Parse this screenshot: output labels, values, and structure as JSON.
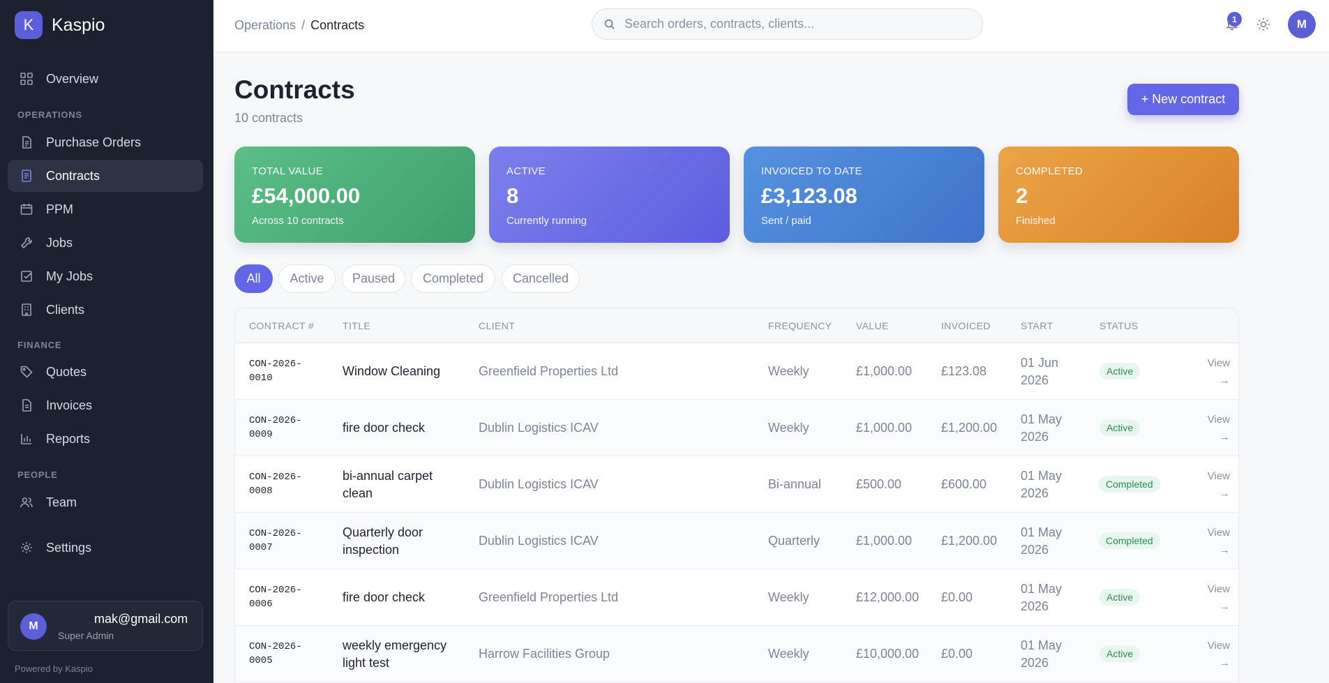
{
  "brand": {
    "logo_letter": "K",
    "name": "Kaspio"
  },
  "sidebar": {
    "overview": "Overview",
    "section_operations": "OPERATIONS",
    "operations": [
      "Purchase Orders",
      "Contracts",
      "PPM",
      "Jobs",
      "My Jobs",
      "Clients"
    ],
    "section_finance": "FINANCE",
    "finance": [
      "Quotes",
      "Invoices",
      "Reports"
    ],
    "section_people": "PEOPLE",
    "people": [
      "Team"
    ],
    "settings": "Settings",
    "active_item": "Contracts"
  },
  "user": {
    "avatar_letter": "M",
    "email": "mak@gmail.com",
    "role": "Super Admin"
  },
  "powered_by": "Powered by Kaspio",
  "topbar": {
    "breadcrumb_parent": "Operations",
    "breadcrumb_separator": "/",
    "breadcrumb_current": "Contracts",
    "search_placeholder": "Search orders, contracts, clients...",
    "notification_count": "1",
    "avatar_letter": "M"
  },
  "page": {
    "title": "Contracts",
    "subtitle": "10 contracts",
    "new_button": "+ New contract"
  },
  "stats": [
    {
      "label": "TOTAL VALUE",
      "value": "£54,000.00",
      "hint": "Across 10 contracts",
      "color": "#4fb07a"
    },
    {
      "label": "ACTIVE",
      "value": "8",
      "hint": "Currently running",
      "color": "#6b6fe6"
    },
    {
      "label": "INVOICED TO DATE",
      "value": "£3,123.08",
      "hint": "Sent / paid",
      "color": "#4a83d6"
    },
    {
      "label": "COMPLETED",
      "value": "2",
      "hint": "Finished",
      "color": "#e29236"
    }
  ],
  "filters": [
    "All",
    "Active",
    "Paused",
    "Completed",
    "Cancelled"
  ],
  "active_filter": "All",
  "table": {
    "headers": [
      "CONTRACT #",
      "TITLE",
      "CLIENT",
      "FREQUENCY",
      "VALUE",
      "INVOICED",
      "START",
      "STATUS"
    ],
    "view_label": "View",
    "view_arrow": "→",
    "rows": [
      {
        "number_a": "CON-2026-",
        "number_b": "0010",
        "title": "Window Cleaning",
        "client": "Greenfield Properties Ltd",
        "frequency": "Weekly",
        "value": "£1,000.00",
        "invoiced": "£123.08",
        "start_a": "01 Jun",
        "start_b": "2026",
        "status": "Active"
      },
      {
        "number_a": "CON-2026-",
        "number_b": "0009",
        "title": "fire door check",
        "client": "Dublin Logistics ICAV",
        "frequency": "Weekly",
        "value": "£1,000.00",
        "invoiced": "£1,200.00",
        "start_a": "01 May",
        "start_b": "2026",
        "status": "Active"
      },
      {
        "number_a": "CON-2026-",
        "number_b": "0008",
        "title": "bi-annual carpet clean",
        "client": "Dublin Logistics ICAV",
        "frequency": "Bi-annual",
        "value": "£500.00",
        "invoiced": "£600.00",
        "start_a": "01 May",
        "start_b": "2026",
        "status": "Completed"
      },
      {
        "number_a": "CON-2026-",
        "number_b": "0007",
        "title": "Quarterly door inspection",
        "client": "Dublin Logistics ICAV",
        "frequency": "Quarterly",
        "value": "£1,000.00",
        "invoiced": "£1,200.00",
        "start_a": "01 May",
        "start_b": "2026",
        "status": "Completed"
      },
      {
        "number_a": "CON-2026-",
        "number_b": "0006",
        "title": "fire door check",
        "client": "Greenfield Properties Ltd",
        "frequency": "Weekly",
        "value": "£12,000.00",
        "invoiced": "£0.00",
        "start_a": "01 May",
        "start_b": "2026",
        "status": "Active"
      },
      {
        "number_a": "CON-2026-",
        "number_b": "0005",
        "title": "weekly emergency light test",
        "client": "Harrow Facilities Group",
        "frequency": "Weekly",
        "value": "£10,000.00",
        "invoiced": "£0.00",
        "start_a": "01 May",
        "start_b": "2026",
        "status": "Active"
      }
    ]
  }
}
